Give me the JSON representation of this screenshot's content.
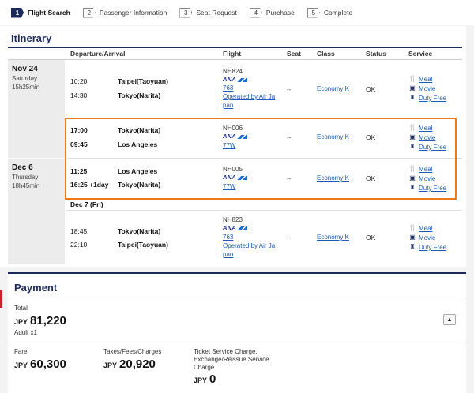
{
  "steps": [
    {
      "num": "1",
      "label": "Flight Search"
    },
    {
      "num": "2",
      "label": "Passenger Information"
    },
    {
      "num": "3",
      "label": "Seat Request"
    },
    {
      "num": "4",
      "label": "Purchase"
    },
    {
      "num": "5",
      "label": "Complete"
    }
  ],
  "itinerary": {
    "title": "Itinerary",
    "headers": {
      "dep_arr": "Departure/Arrival",
      "flight": "Flight",
      "seat": "Seat",
      "class": "Class",
      "status": "Status",
      "service": "Service"
    },
    "dates": [
      {
        "date": "Nov 24",
        "day": "Saturday",
        "duration": "15h25min"
      },
      {
        "date": "Dec 6",
        "day": "Thursday",
        "duration": "18h45min"
      }
    ],
    "sub_date": "Dec 7 (Fri)",
    "segments": [
      {
        "dep_time": "10:20",
        "dep_city": "Taipei(Taoyuan)",
        "arr_time": "14:30",
        "arr_city": "Tokyo(Narita)",
        "flight_no": "NH824",
        "airline": "ANA",
        "aircraft": "763",
        "operated_1": "Operated by Air Ja",
        "operated_2": "pan",
        "seat": "--",
        "class": "Economy:K",
        "status": "OK"
      },
      {
        "dep_time": "17:00",
        "dep_city": "Tokyo(Narita)",
        "arr_time": "09:45",
        "arr_city": "Los Angeles",
        "flight_no": "NH006",
        "airline": "ANA",
        "aircraft": "77W",
        "seat": "--",
        "class": "Economy:K",
        "status": "OK"
      },
      {
        "dep_time": "11:25",
        "dep_city": "Los Angeles",
        "arr_time": "16:25 +1day",
        "arr_city": "Tokyo(Narita)",
        "flight_no": "NH005",
        "airline": "ANA",
        "aircraft": "77W",
        "seat": "--",
        "class": "Economy:K",
        "status": "OK"
      },
      {
        "dep_time": "18:45",
        "dep_city": "Tokyo(Narita)",
        "arr_time": "22:10",
        "arr_city": "Taipei(Taoyuan)",
        "flight_no": "NH823",
        "airline": "ANA",
        "aircraft": "763",
        "operated_1": "Operated by Air Ja",
        "operated_2": "pan",
        "seat": "--",
        "class": "Economy:K",
        "status": "OK"
      }
    ],
    "service_links": {
      "meal": "Meal",
      "movie": "Movie",
      "duty_free": "Duty Free"
    },
    "icons": {
      "meal": "meal-icon",
      "movie": "movie-icon",
      "duty_free": "duty-free-icon"
    }
  },
  "payment": {
    "title": "Payment",
    "total_label": "Total",
    "total_currency": "JPY",
    "total_value": "81,220",
    "adult": "Adult x1",
    "fare_label": "Fare",
    "fare_currency": "JPY",
    "fare_value": "60,300",
    "taxes_label": "Taxes/Fees/Charges",
    "taxes_currency": "JPY",
    "taxes_value": "20,920",
    "ticket_label_1": "Ticket Service Charge,",
    "ticket_label_2": "Exchange/Reissue Service",
    "ticket_label_3": "Charge",
    "ticket_currency": "JPY",
    "ticket_value": "0",
    "collapse_icon": "caret-up-icon"
  },
  "colors": {
    "brand": "#1a2a5c",
    "highlight": "#f07a14",
    "link": "#1a5bb5"
  }
}
